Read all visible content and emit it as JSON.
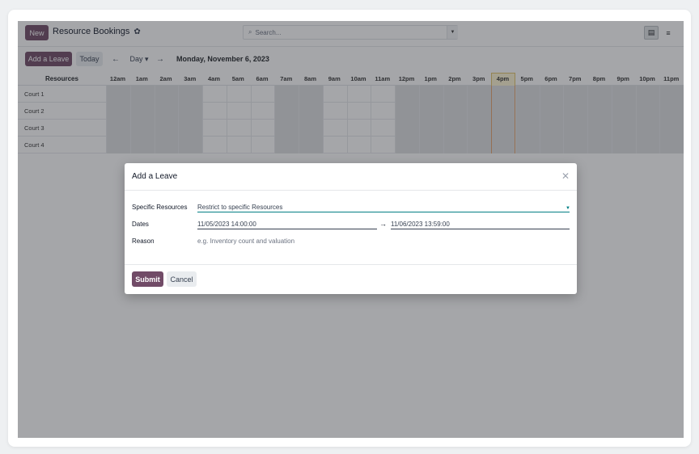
{
  "control_panel": {
    "new_label": "New",
    "title": "Resource Bookings",
    "search_placeholder": "Search...",
    "add_leave_label": "Add a Leave",
    "today_label": "Today",
    "scale_label": "Day ▾",
    "date_label": "Monday, November 6, 2023"
  },
  "gantt": {
    "resources_header": "Resources",
    "hours": [
      "12am",
      "1am",
      "2am",
      "3am",
      "4am",
      "5am",
      "6am",
      "7am",
      "8am",
      "9am",
      "10am",
      "11am",
      "12pm",
      "1pm",
      "2pm",
      "3pm",
      "4pm",
      "5pm",
      "6pm",
      "7pm",
      "8pm",
      "9pm",
      "10pm",
      "11pm"
    ],
    "rows": [
      {
        "label": "Court 1"
      },
      {
        "label": "Court 2"
      },
      {
        "label": "Court 3"
      },
      {
        "label": "Court 4"
      }
    ]
  },
  "modal": {
    "title": "Add a Leave",
    "resources_label": "Specific Resources",
    "resources_placeholder": "Restrict to specific Resources",
    "dates_label": "Dates",
    "date_start": "11/05/2023 14:00:00",
    "date_end": "11/06/2023 13:59:00",
    "reason_label": "Reason",
    "reason_placeholder": "e.g. Inventory count and valuation",
    "submit_label": "Submit",
    "cancel_label": "Cancel"
  },
  "colors": {
    "brand": "#714b67",
    "accent": "#017e84",
    "today_highlight": "#fdf4d3"
  }
}
